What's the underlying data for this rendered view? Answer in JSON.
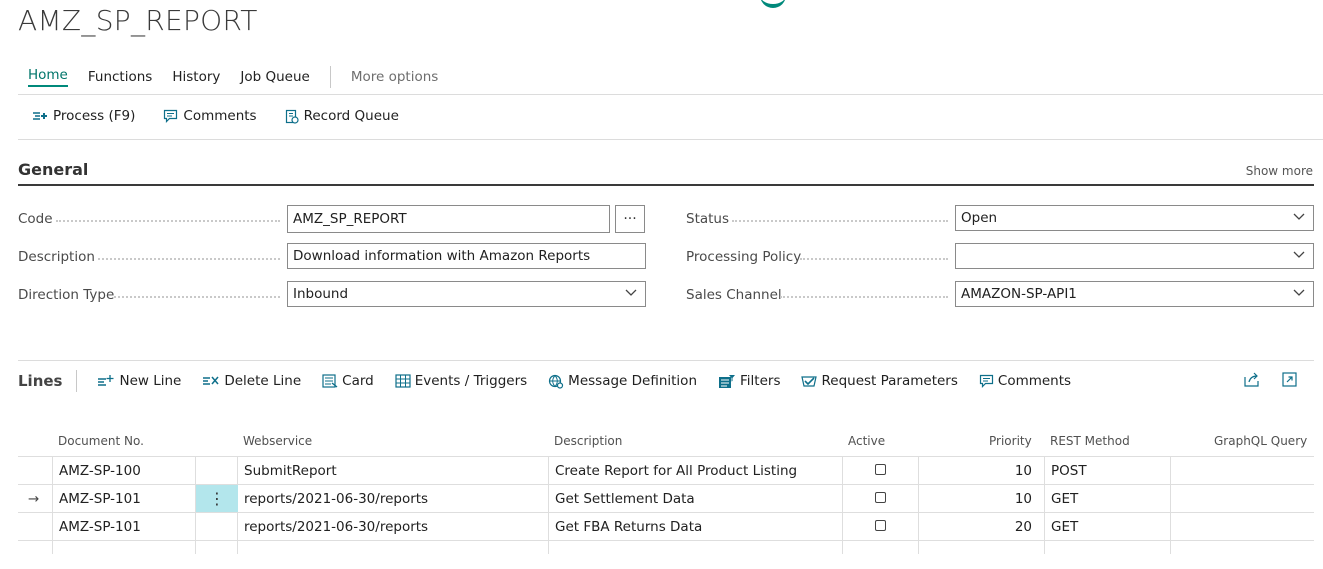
{
  "page": {
    "title": "AMZ_SP_REPORT"
  },
  "nav": {
    "tabs": [
      "Home",
      "Functions",
      "History",
      "Job Queue"
    ],
    "more": "More options"
  },
  "actions": {
    "process": "Process (F9)",
    "comments": "Comments",
    "record_queue": "Record Queue"
  },
  "general": {
    "title": "General",
    "show_more": "Show more",
    "code": {
      "label": "Code",
      "value": "AMZ_SP_REPORT",
      "assist": "···"
    },
    "description": {
      "label": "Description",
      "value": "Download information with Amazon Reports"
    },
    "direction_type": {
      "label": "Direction Type",
      "value": "Inbound"
    },
    "status": {
      "label": "Status",
      "value": "Open"
    },
    "processing_policy": {
      "label": "Processing Policy",
      "value": ""
    },
    "sales_channel": {
      "label": "Sales Channel",
      "value": "AMAZON-SP-API1"
    }
  },
  "lines": {
    "title": "Lines",
    "actions": {
      "new_line": "New Line",
      "delete_line": "Delete Line",
      "card": "Card",
      "events": "Events / Triggers",
      "message_definition": "Message Definition",
      "filters": "Filters",
      "request_parameters": "Request Parameters",
      "comments": "Comments"
    },
    "columns": {
      "document_no": "Document No.",
      "webservice": "Webservice",
      "description": "Description",
      "active": "Active",
      "priority": "Priority",
      "rest_method": "REST Method",
      "graphql_query": "GraphQL Query"
    },
    "rows": [
      {
        "indicator": "",
        "document_no": "AMZ-SP-100",
        "webservice": "SubmitReport",
        "description": "Create Report for All Product Listing",
        "priority": "10",
        "rest_method": "POST"
      },
      {
        "indicator": "→",
        "document_no": "AMZ-SP-101",
        "webservice": "reports/2021-06-30/reports",
        "description": "Get Settlement Data",
        "priority": "10",
        "rest_method": "GET"
      },
      {
        "indicator": "",
        "document_no": "AMZ-SP-101",
        "webservice": "reports/2021-06-30/reports",
        "description": "Get FBA Returns Data",
        "priority": "20",
        "rest_method": "GET"
      }
    ],
    "row_menu": "⋮"
  }
}
